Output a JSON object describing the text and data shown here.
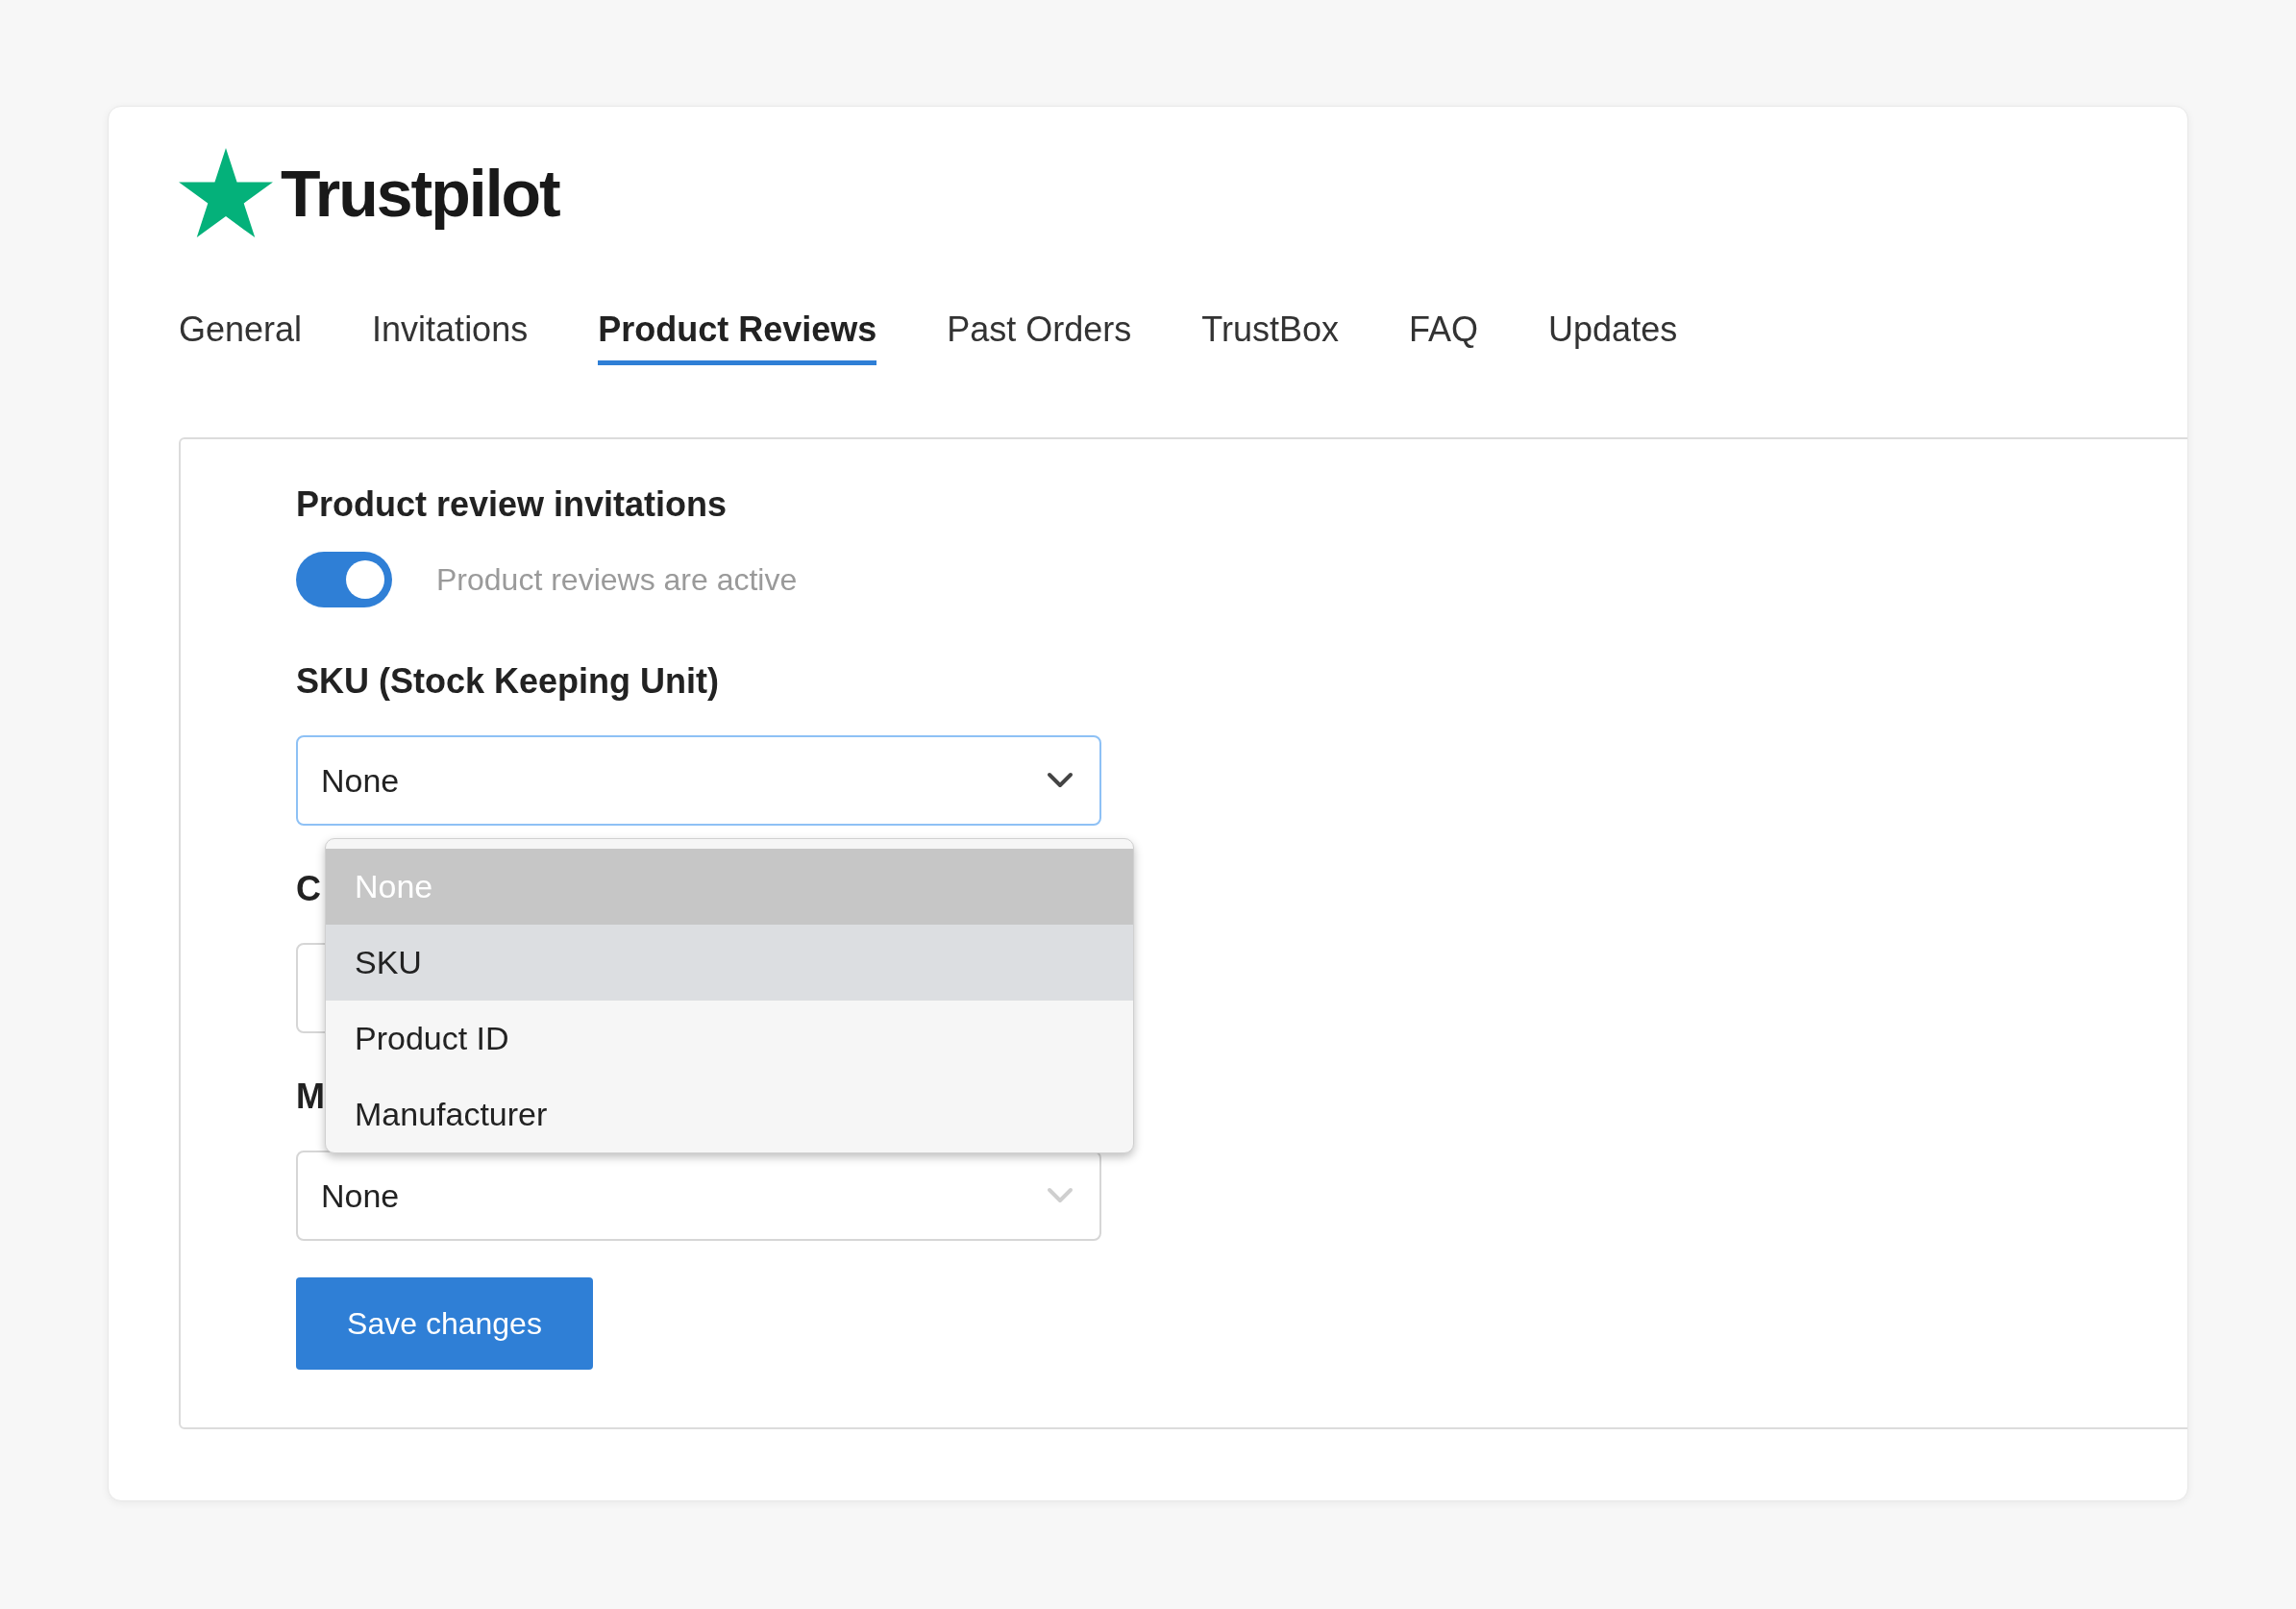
{
  "logo": {
    "text": "Trustpilot"
  },
  "tabs": [
    {
      "label": "General",
      "selected": false
    },
    {
      "label": "Invitations",
      "selected": false
    },
    {
      "label": "Product Reviews",
      "selected": true
    },
    {
      "label": "Past Orders",
      "selected": false
    },
    {
      "label": "TrustBox",
      "selected": false
    },
    {
      "label": "FAQ",
      "selected": false
    },
    {
      "label": "Updates",
      "selected": false
    }
  ],
  "section": {
    "title": "Product review invitations",
    "toggle": {
      "on": true,
      "label": "Product reviews are active"
    }
  },
  "fields": [
    {
      "label": "SKU (Stock Keeping Unit)",
      "value": "None",
      "focused": true
    },
    {
      "label": "C",
      "focused": false
    },
    {
      "label": "M",
      "value": "None",
      "focused": false
    }
  ],
  "dropdown": {
    "options": [
      {
        "label": "None",
        "disabled": true,
        "selected": false
      },
      {
        "label": "SKU",
        "disabled": false,
        "selected": true
      },
      {
        "label": "Product ID",
        "disabled": false,
        "selected": false
      },
      {
        "label": "Manufacturer",
        "disabled": false,
        "selected": false
      }
    ]
  },
  "save_button": "Save changes"
}
